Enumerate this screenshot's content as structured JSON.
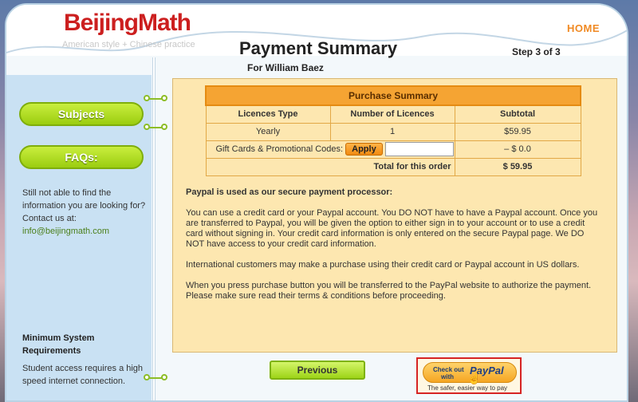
{
  "brand": {
    "logo_text": "BeijingMath",
    "tagline": "American style + Chinese practice"
  },
  "nav": {
    "home_label": "HOME"
  },
  "page": {
    "title": "Payment Summary",
    "step": "Step 3 of 3",
    "for_name": "For William Baez"
  },
  "sidebar": {
    "subjects_label": "Subjects",
    "faqs_label": "FAQs:",
    "help_text": "Still not able to find the information you are looking for?",
    "contact_label": "Contact us at:",
    "contact_email": "info@beijingmath.com",
    "req_title": "Minimum System Requirements",
    "req_text": "Student access requires a high speed internet connection."
  },
  "summary": {
    "header": "Purchase Summary",
    "columns": [
      "Licences Type",
      "Number of Licences",
      "Subtotal"
    ],
    "row": {
      "type": "Yearly",
      "count": "1",
      "subtotal": "$59.95"
    },
    "promo_label": "Gift Cards & Promotional Codes:",
    "apply_label": "Apply",
    "promo_value": "",
    "promo_discount": "– $ 0.0",
    "total_label": "Total for this order",
    "total_value": "$ 59.95"
  },
  "info": {
    "heading": "Paypal is used as our secure payment processor:",
    "p1": "You can use a credit card or your Paypal account. You DO NOT have to have a Paypal account. Once you are transferred to Paypal, you will be given the option to either sign in to your account or to use a credit card without signing in. Your credit card information is only entered on the secure Paypal page. We DO NOT have access to your credit card information.",
    "p2": "International customers may make a purchase using their credit card or Paypal account in US dollars.",
    "p3": "When you press purchase button you will be transferred to the PayPal website to authorize the payment. Please make sure read their terms & conditions before proceeding."
  },
  "actions": {
    "previous_label": "Previous",
    "paypal_line1": "Check out",
    "paypal_line2": "with",
    "paypal_word": "PayPal",
    "paypal_tagline": "The safer, easier way to pay"
  }
}
